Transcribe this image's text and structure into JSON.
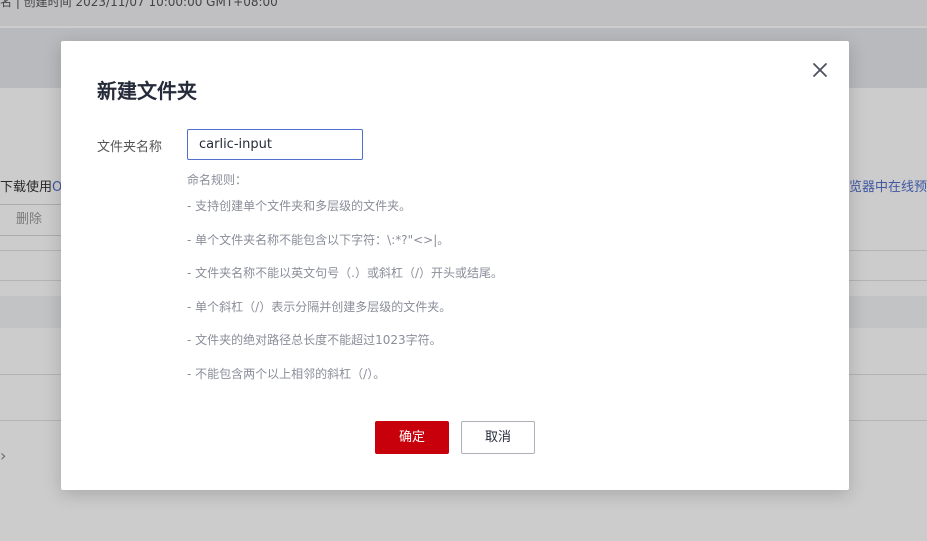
{
  "background": {
    "top_text": "名 | 创建时间 2023/11/07 10:00:00 GMT+08:00",
    "left_text_prefix": "下载使用",
    "left_text_link": "O",
    "right_text": "览器中在线预",
    "delete_button": "删除",
    "chevron": "›"
  },
  "dialog": {
    "title": "新建文件夹",
    "close_icon": "close-icon",
    "field_label": "文件夹名称",
    "input_value": "carlic-input",
    "rules_title": "命名规则：",
    "rules": [
      "- 支持创建单个文件夹和多层级的文件夹。",
      "- 单个文件夹名称不能包含以下字符：\\:*?\"<>|。",
      "- 文件夹名称不能以英文句号（.）或斜杠（/）开头或结尾。",
      "- 单个斜杠（/）表示分隔并创建多层级的文件夹。",
      "- 文件夹的绝对路径总长度不能超过1023字符。",
      "- 不能包含两个以上相邻的斜杠（/）。"
    ],
    "confirm_label": "确定",
    "cancel_label": "取消"
  },
  "colors": {
    "primary": "#c7000b",
    "input_border": "#526ecc",
    "overlay": "rgba(0,0,0,0.2)"
  }
}
